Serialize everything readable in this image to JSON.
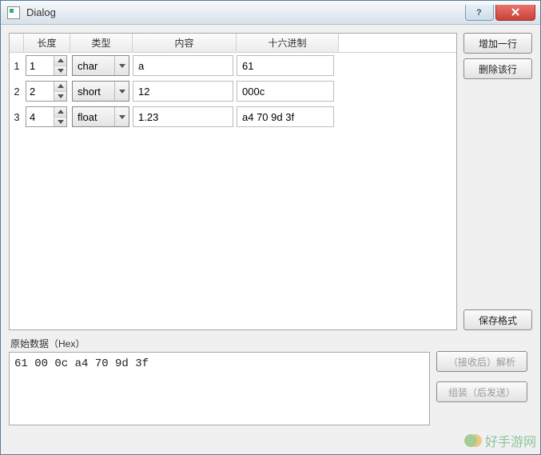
{
  "window": {
    "title": "Dialog"
  },
  "table": {
    "headers": {
      "length": "长度",
      "type": "类型",
      "content": "内容",
      "hex": "十六进制"
    },
    "rows": [
      {
        "idx": "1",
        "length": "1",
        "type": "char",
        "content": "a",
        "hex": "61"
      },
      {
        "idx": "2",
        "length": "2",
        "type": "short",
        "content": "12",
        "hex": "000c"
      },
      {
        "idx": "3",
        "length": "4",
        "type": "float",
        "content": "1.23",
        "hex": "a4 70 9d 3f"
      }
    ]
  },
  "buttons": {
    "addRow": "增加一行",
    "deleteRow": "删除该行",
    "saveFormat": "保存格式",
    "parseAfterRecv": "（接收后）解析",
    "assembleAfterSend": "组装（后发送）"
  },
  "raw": {
    "label": "原始数据（Hex）",
    "value": "61 00 0c a4 70 9d 3f"
  },
  "watermark": "好手游网"
}
